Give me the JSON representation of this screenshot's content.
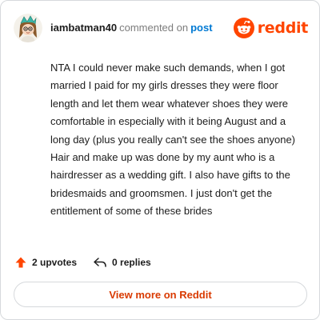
{
  "header": {
    "username": "iambatman40",
    "action_text": "commented on",
    "post_link": "post",
    "brand": "reddit",
    "avatar_icon": "snoo-avatar-icon",
    "brand_icon": "reddit-alien-icon"
  },
  "comment": {
    "text": "NTA I could never make such demands, when I got married I paid for my girls dresses they were floor length and let them wear whatever shoes they were comfortable in especially with it being August and a long day (plus you really can't see the shoes anyone) Hair and make up was done by my aunt who is a hairdresser as a wedding gift. I also have gifts to the bridesmaids and groomsmen. I just don't get the entitlement of some of these brides"
  },
  "actions": {
    "upvotes": "2 upvotes",
    "replies": "0 replies",
    "upvote_icon": "upvote-arrow-icon",
    "reply_icon": "reply-arrow-icon"
  },
  "footer": {
    "button_label": "View more on Reddit"
  },
  "colors": {
    "brand": "#ff4500",
    "link": "#0079d3",
    "button_text": "#d93a00",
    "border": "#d6d9dc"
  }
}
